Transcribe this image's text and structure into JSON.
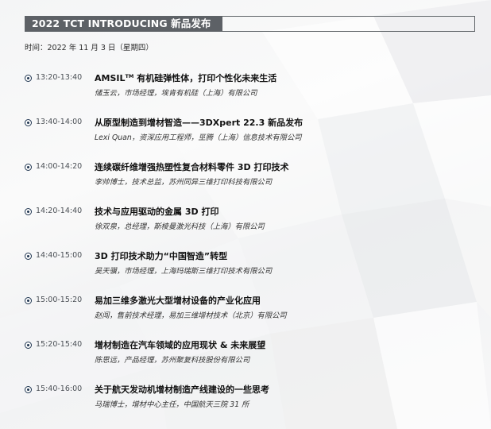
{
  "header": {
    "title": "2022 TCT INTRODUCING 新品发布"
  },
  "date_line": "时间：2022 年 11 月 3 日（星期四）",
  "agenda": [
    {
      "time": "13:20-13:40",
      "title": "AMSIL",
      "title_sup": "TM",
      "title_rest": " 有机硅弹性体，打印个性化未来生活",
      "speaker": "储玉云，市场经理，埃肯有机硅（上海）有限公司"
    },
    {
      "time": "13:40-14:00",
      "title": "从原型制造到增材智造——3DXpert 22.3 新品发布",
      "title_sup": "",
      "title_rest": "",
      "speaker": "Lexi Quan，资深应用工程师，巠腾（上海）信息技术有限公司"
    },
    {
      "time": "14:00-14:20",
      "title": "连续碳纤维增强热塑性复合材料零件 3D 打印技术",
      "title_sup": "",
      "title_rest": "",
      "speaker": "李帅博士，技术总监，苏州同异三维打印科技有限公司"
    },
    {
      "time": "14:20-14:40",
      "title": "技术与应用驱动的金属 3D 打印",
      "title_sup": "",
      "title_rest": "",
      "speaker": "徐双泉，总经理，斯棱曼激光科技（上海）有限公司"
    },
    {
      "time": "14:40-15:00",
      "title": "3D 打印技术助力“中国智造”转型",
      "title_sup": "",
      "title_rest": "",
      "speaker": "吴天骥，市场经理，上海玛瑞斯三维打印技术有限公司"
    },
    {
      "time": "15:00-15:20",
      "title": "易加三维多激光大型增材设备的产业化应用",
      "title_sup": "",
      "title_rest": "",
      "speaker": "赵闯，售前技术经理，易加三维增材技术（北京）有限公司"
    },
    {
      "time": "15:20-15:40",
      "title": "增材制造在汽车领域的应用现状 & 未来展望",
      "title_sup": "",
      "title_rest": "",
      "speaker": "陈思远，产品经理，苏州聚复科技股份有限公司"
    },
    {
      "time": "15:40-16:00",
      "title": "关于航天发动机增材制造产线建设的一些思考",
      "title_sup": "",
      "title_rest": "",
      "speaker": "马瑞博士，增材中心主任，中国航天三院 31 所"
    }
  ]
}
